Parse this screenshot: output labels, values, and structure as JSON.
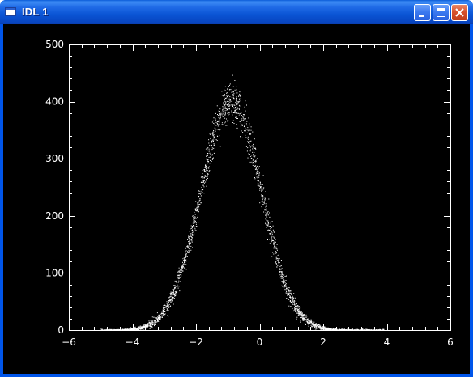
{
  "window": {
    "title": "IDL 1",
    "buttons": {
      "minimize": "minimize-icon",
      "maximize": "maximize-icon",
      "close": "close-icon"
    }
  },
  "colors": {
    "titlebar": "#0a54d4",
    "plot_background": "#000000",
    "plot_foreground": "#ffffff"
  },
  "chart_data": {
    "type": "scatter",
    "title": "",
    "xlabel": "",
    "ylabel": "",
    "xlim": [
      -6,
      6
    ],
    "ylim": [
      0,
      500
    ],
    "xticks": [
      -6,
      -4,
      -2,
      0,
      2,
      4,
      6
    ],
    "xtick_labels": [
      "−6",
      "−4",
      "−2",
      "0",
      "2",
      "4",
      "6"
    ],
    "yticks": [
      0,
      100,
      200,
      300,
      400,
      500
    ],
    "ytick_labels": [
      "0",
      "100",
      "200",
      "300",
      "400",
      "500"
    ],
    "grid": false,
    "series": [
      {
        "distribution": "gaussian",
        "peak_x": -0.9,
        "peak_y": 400,
        "sigma": 0.95,
        "x_min": -5.0,
        "x_max": 3.9,
        "point_count": 3000,
        "marker": "dot",
        "color": "#ffffff"
      }
    ]
  }
}
